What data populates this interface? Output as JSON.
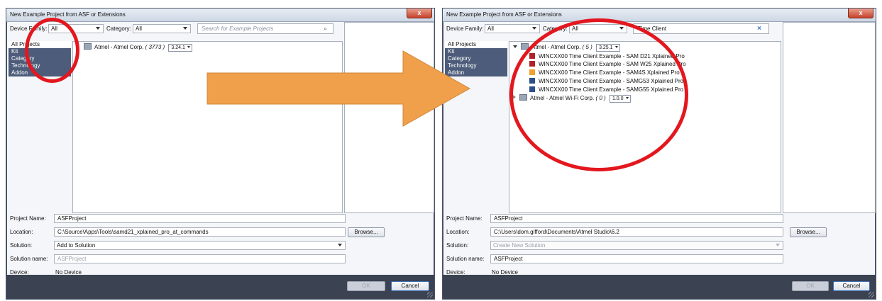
{
  "left": {
    "title": "New Example Project from ASF or Extensions",
    "close_glyph": "x",
    "device_family_label": "Device Family:",
    "device_family_value": "All",
    "category_label": "Category:",
    "category_value": "All",
    "search_placeholder": "Search for Example Projects",
    "search_icon": "search-icon",
    "categories": [
      "All Projects",
      "Kit",
      "Category",
      "Technology",
      "Addon"
    ],
    "tree": {
      "vendor": "Atmel - Atmel Corp.",
      "count": "( 3773 )",
      "version": "3.24.1"
    },
    "project_name_label": "Project Name:",
    "project_name_value": "ASFProject",
    "location_label": "Location:",
    "location_value": "C:\\Source\\Apps\\Tools\\samd21_xplained_pro_at_commands",
    "browse_label": "Browse...",
    "solution_label": "Solution:",
    "solution_value": "Add to Solution",
    "solution_name_label": "Solution name:",
    "solution_name_value": "ASFProject",
    "device_label": "Device:",
    "device_value": "No Device",
    "ok_label": "OK",
    "cancel_label": "Cancel"
  },
  "right": {
    "title": "New Example Project from ASF or Extensions",
    "close_glyph": "x",
    "device_family_label": "Device Family:",
    "device_family_value": "All",
    "category_label": "Category:",
    "category_value": "All",
    "search_value": "Time Client",
    "clear_glyph": "×",
    "categories": [
      "All Projects",
      "Kit",
      "Category",
      "Technology",
      "Addon"
    ],
    "tree": {
      "vendor": "Atmel - Atmel Corp.",
      "count": "( 5 )",
      "version": "3.25.1",
      "items": [
        "WINCXX00 Time Client Example - SAM D21 Xplained Pro",
        "WINCXX00 Time Client Example - SAM W25 Xplained Pro",
        "WINCXX00 Time Client Example - SAM4S Xplained Pro",
        "WINCXX00 Time Client Example - SAMG53 Xplained Pro",
        "WINCXX00 Time Client Example - SAMG55 Xplained Pro"
      ],
      "vendor2": "Atmel - Atmel Wi-Fi Corp.",
      "count2": "( 0 )",
      "version2": "1.0.0"
    },
    "project_name_label": "Project Name:",
    "project_name_value": "ASFProject",
    "location_label": "Location:",
    "location_value": "C:\\Users\\dom.gifford\\Documents\\Atmel Studio\\6.2",
    "browse_label": "Browse...",
    "solution_label": "Solution:",
    "solution_value": "Create New Solution",
    "solution_name_label": "Solution name:",
    "solution_name_value": "ASFProject",
    "device_label": "Device:",
    "device_value": "No Device",
    "ok_label": "OK",
    "cancel_label": "Cancel"
  },
  "colors": {
    "arrow": "#f0a04b",
    "highlight_circle": "#e3171e",
    "category_bg": "#4d5c7a",
    "footer_bg": "#3b4252",
    "project_icon_red": "#b0202a",
    "project_icon_orange": "#f0a030",
    "project_icon_blue": "#2a4f8a"
  }
}
